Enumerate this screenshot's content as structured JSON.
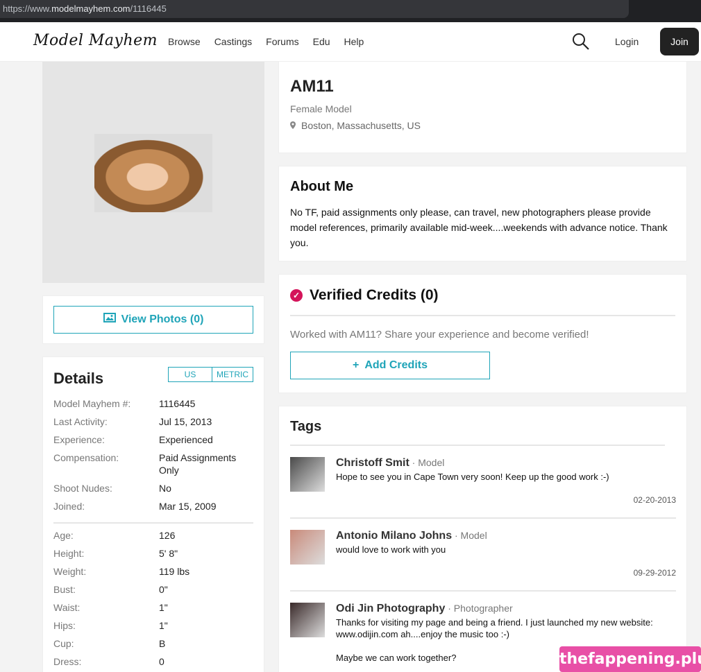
{
  "browser": {
    "url_prefix": "https://www.",
    "url_domain": "modelmayhem.com",
    "url_path": "/1116445"
  },
  "nav": {
    "logo": "Model Mayhem",
    "links": [
      "Browse",
      "Castings",
      "Forums",
      "Edu",
      "Help"
    ],
    "login": "Login",
    "join": "Join"
  },
  "profile": {
    "name": "AM11",
    "role": "Female Model",
    "location": "Boston, Massachusetts, US",
    "view_photos": "View Photos (0)"
  },
  "about": {
    "title": "About Me",
    "text": "No TF, paid assignments only please, can travel, new photographers please provide model references, primarily available mid-week....weekends with advance notice. Thank you."
  },
  "credits": {
    "title": "Verified Credits (0)",
    "text": "Worked with AM11? Share your experience and become verified!",
    "add": "Add Credits"
  },
  "details": {
    "title": "Details",
    "unit_us": "US",
    "unit_metric": "METRIC",
    "rows1": [
      {
        "k": "Model Mayhem #:",
        "v": "1116445"
      },
      {
        "k": "Last Activity:",
        "v": "Jul 15, 2013"
      },
      {
        "k": "Experience:",
        "v": "Experienced"
      },
      {
        "k": "Compensation:",
        "v": "Paid Assignments Only"
      },
      {
        "k": "Shoot Nudes:",
        "v": "No"
      },
      {
        "k": "Joined:",
        "v": "Mar 15, 2009"
      }
    ],
    "rows2": [
      {
        "k": "Age:",
        "v": "126"
      },
      {
        "k": "Height:",
        "v": "5' 8\""
      },
      {
        "k": "Weight:",
        "v": "119 lbs"
      },
      {
        "k": "Bust:",
        "v": "0\""
      },
      {
        "k": "Waist:",
        "v": "1\""
      },
      {
        "k": "Hips:",
        "v": "1\""
      },
      {
        "k": "Cup:",
        "v": "B"
      },
      {
        "k": "Dress:",
        "v": "0"
      }
    ]
  },
  "tags": {
    "title": "Tags",
    "items": [
      {
        "name": "Christoff Smit",
        "role": "Model",
        "msg": "Hope to see you in Cape Town very soon! Keep up the good work :-)",
        "date": "02-20-2013"
      },
      {
        "name": "Antonio Milano Johns",
        "role": "Model",
        "msg": "would love to work with you",
        "date": "09-29-2012"
      },
      {
        "name": "Odi Jin Photography",
        "role": "Photographer",
        "msg": "Thanks for visiting my page and being a friend. I just launched my new website:\nwww.odijin.com ah....enjoy the music too :-)\n\nMaybe we can work together?",
        "date": ""
      }
    ]
  },
  "watermark": "thefappening.plus"
}
